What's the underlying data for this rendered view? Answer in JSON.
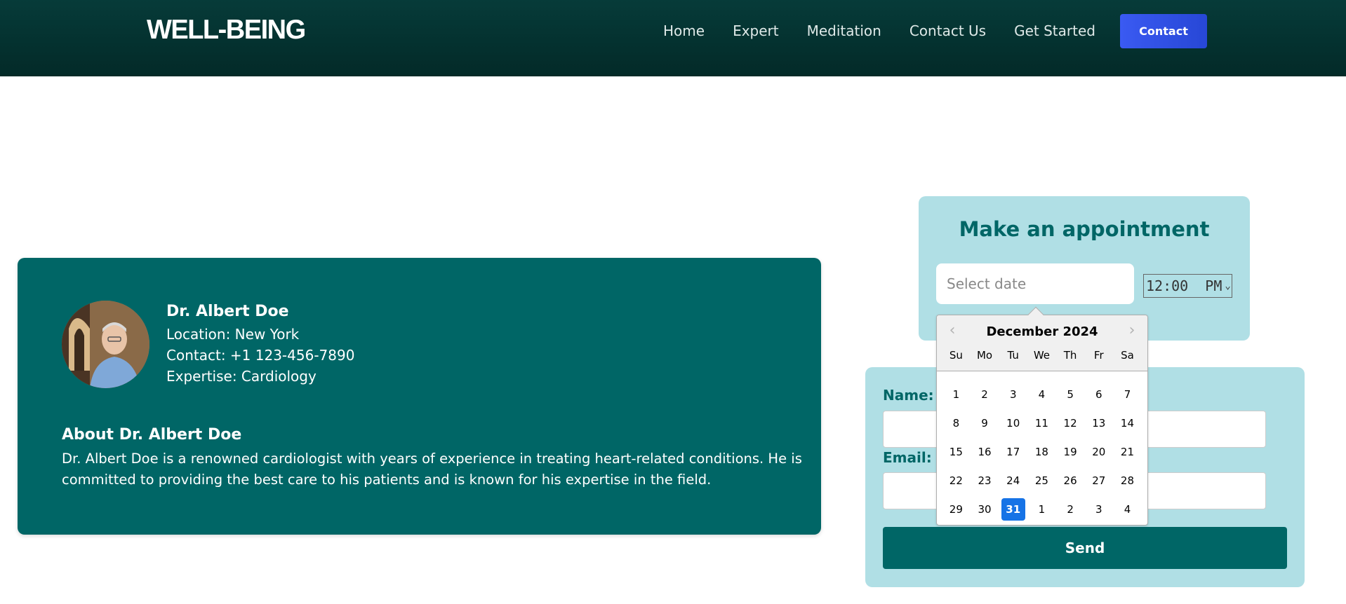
{
  "nav": {
    "logo": "WELL-BEING",
    "links": [
      {
        "label": "Home"
      },
      {
        "label": "Expert"
      },
      {
        "label": "Meditation"
      },
      {
        "label": "Contact Us"
      },
      {
        "label": "Get Started"
      }
    ],
    "cta_label": "Contact"
  },
  "doctor": {
    "name": "Dr. Albert Doe",
    "location": "Location: New York",
    "contact": "Contact: +1 123-456-7890",
    "expertise": "Expertise: Cardiology",
    "about_title": "About Dr. Albert Doe",
    "about_text": "Dr. Albert Doe is a renowned cardiologist with years of experience in treating heart-related conditions. He is committed to providing the best care to his patients and is known for his expertise in the field."
  },
  "appointment": {
    "title": "Make an appointment",
    "date_placeholder": "Select date",
    "time_value": "12:00  PM"
  },
  "calendar": {
    "month_label": "December 2024",
    "days_of_week": [
      "Su",
      "Mo",
      "Tu",
      "We",
      "Th",
      "Fr",
      "Sa"
    ],
    "days": [
      "1",
      "2",
      "3",
      "4",
      "5",
      "6",
      "7",
      "8",
      "9",
      "10",
      "11",
      "12",
      "13",
      "14",
      "15",
      "16",
      "17",
      "18",
      "19",
      "20",
      "21",
      "22",
      "23",
      "24",
      "25",
      "26",
      "27",
      "28",
      "29",
      "30",
      "31",
      "1",
      "2",
      "3",
      "4"
    ],
    "selected_day": "31"
  },
  "form": {
    "name_label": "Name:",
    "email_label": "Email:",
    "send_label": "Send"
  },
  "colors": {
    "nav_bg": "#063b39",
    "primary_teal": "#006666",
    "light_teal": "#b0dfe5",
    "cta_blue": "#3a5af2",
    "selected_day": "#1673e6"
  }
}
